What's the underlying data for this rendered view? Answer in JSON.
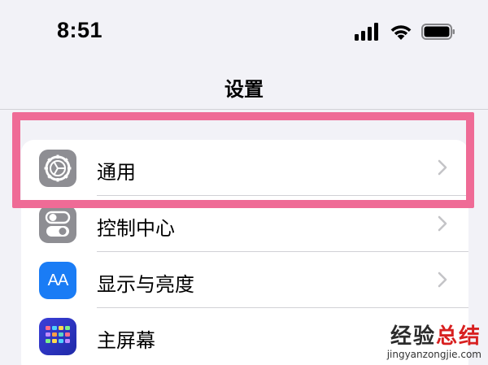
{
  "status_bar": {
    "time": "8:51",
    "icons": [
      "signal-icon",
      "wifi-icon",
      "battery-icon"
    ]
  },
  "nav": {
    "title": "设置"
  },
  "settings": {
    "items": [
      {
        "label": "通用",
        "icon": "gear-icon",
        "icon_color": "#8e8e93"
      },
      {
        "label": "控制中心",
        "icon": "toggles-icon",
        "icon_color": "#8e8e93"
      },
      {
        "label": "显示与亮度",
        "icon": "text-size-icon",
        "icon_text": "AA",
        "icon_color": "#1a7cf5"
      },
      {
        "label": "主屏幕",
        "icon": "app-grid-icon",
        "icon_color": "#2a33c0"
      }
    ]
  },
  "highlight": {
    "color": "#ef6b96",
    "target": "通用"
  },
  "watermark": {
    "text_main": "经验",
    "text_accent": "总结",
    "url": "jingyanzongjie.com"
  }
}
